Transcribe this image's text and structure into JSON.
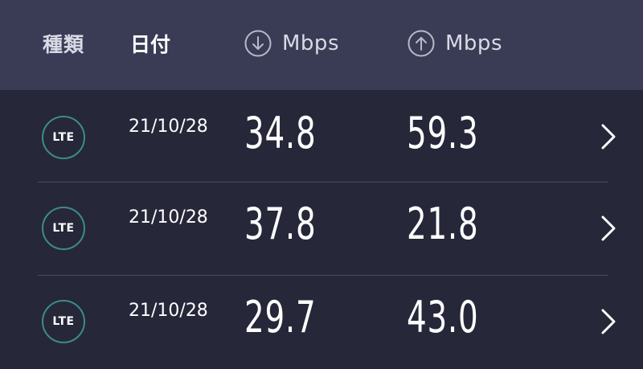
{
  "header": {
    "type_label": "種類",
    "date_label": "日付",
    "download_icon": "arrow-down-circle-icon",
    "download_unit": "Mbps",
    "upload_icon": "arrow-up-circle-icon",
    "upload_unit": "Mbps"
  },
  "rows": [
    {
      "type": "LTE",
      "date": "21/10/28",
      "download": "34.8",
      "upload": "59.3",
      "chevron_icon": "chevron-right-icon"
    },
    {
      "type": "LTE",
      "date": "21/10/28",
      "download": "37.8",
      "upload": "21.8",
      "chevron_icon": "chevron-right-icon"
    },
    {
      "type": "LTE",
      "date": "21/10/28",
      "download": "29.7",
      "upload": "43.0",
      "chevron_icon": "chevron-right-icon"
    }
  ],
  "colors": {
    "background": "#262739",
    "header_background": "#3a3c55",
    "badge_ring": "#3c8c88",
    "divider": "#4a4c62"
  }
}
